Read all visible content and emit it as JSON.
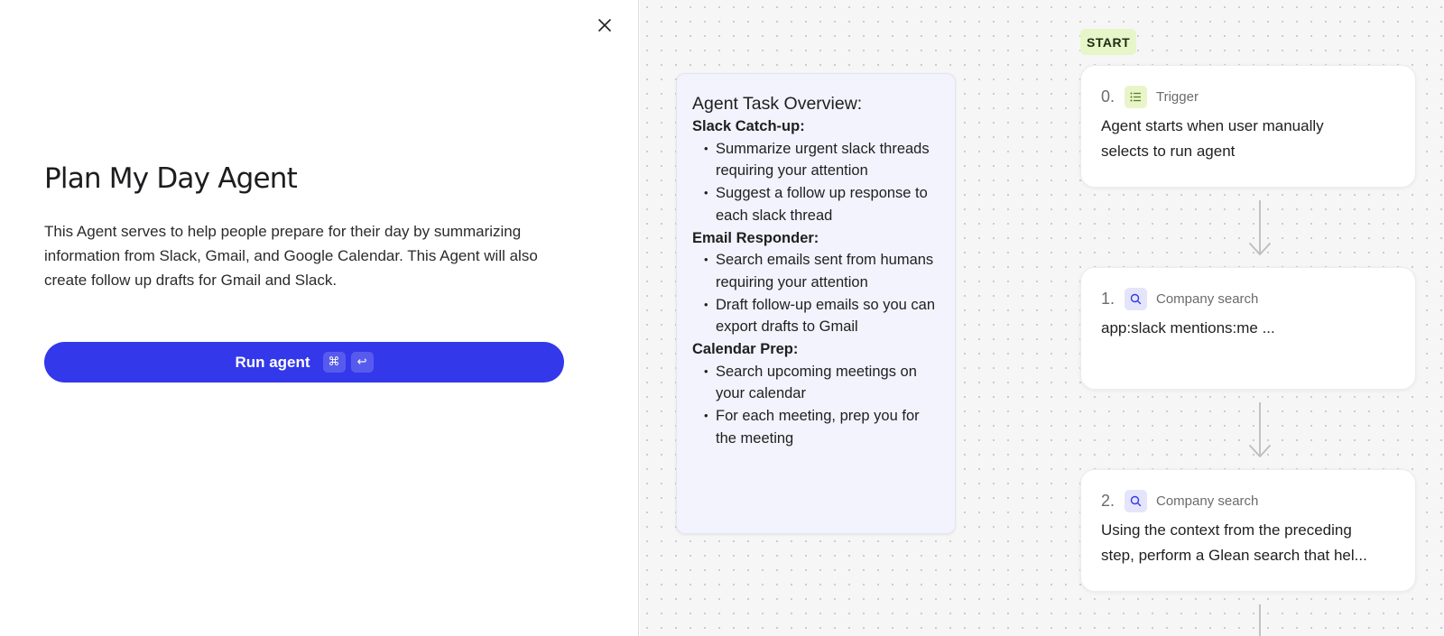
{
  "modal": {
    "title": "Plan My Day Agent",
    "description": "This Agent serves to help people prepare for their day by summarizing information from Slack, Gmail, and Google Calendar. This Agent will also create follow up drafts for Gmail and Slack.",
    "run_button": {
      "label": "Run agent",
      "shortcut_keys": [
        "⌘",
        "↩"
      ]
    },
    "close_icon": "close-icon"
  },
  "overview": {
    "title": "Agent Task Overview:",
    "sections": [
      {
        "heading": "Slack Catch-up:",
        "items": [
          "Summarize urgent slack threads requiring your attention",
          "Suggest a follow up response to each slack thread"
        ]
      },
      {
        "heading": "Email Responder:",
        "items": [
          "Search emails sent from humans requiring your attention",
          "Draft follow-up emails so you can export drafts to Gmail"
        ]
      },
      {
        "heading": "Calendar Prep:",
        "items": [
          "Search upcoming meetings on your calendar",
          "For each meeting, prep you for the meeting"
        ]
      }
    ]
  },
  "flow": {
    "start_label": "START",
    "steps": [
      {
        "number": "0.",
        "type": "Trigger",
        "icon": "list-icon",
        "line1": "Agent starts when user manually",
        "line2": "selects to run agent"
      },
      {
        "number": "1.",
        "type": "Company search",
        "icon": "search-icon",
        "line1": "app:slack mentions:me ...",
        "line2": ""
      },
      {
        "number": "2.",
        "type": "Company search",
        "icon": "search-icon",
        "line1": "Using the context from the preceding",
        "line2": "step, perform a Glean search that hel..."
      }
    ]
  },
  "colors": {
    "accent": "#3338ea",
    "start_badge": "#e7f6c9",
    "overview_bg": "#f2f3fd",
    "canvas_bg": "#f6f6f6"
  }
}
